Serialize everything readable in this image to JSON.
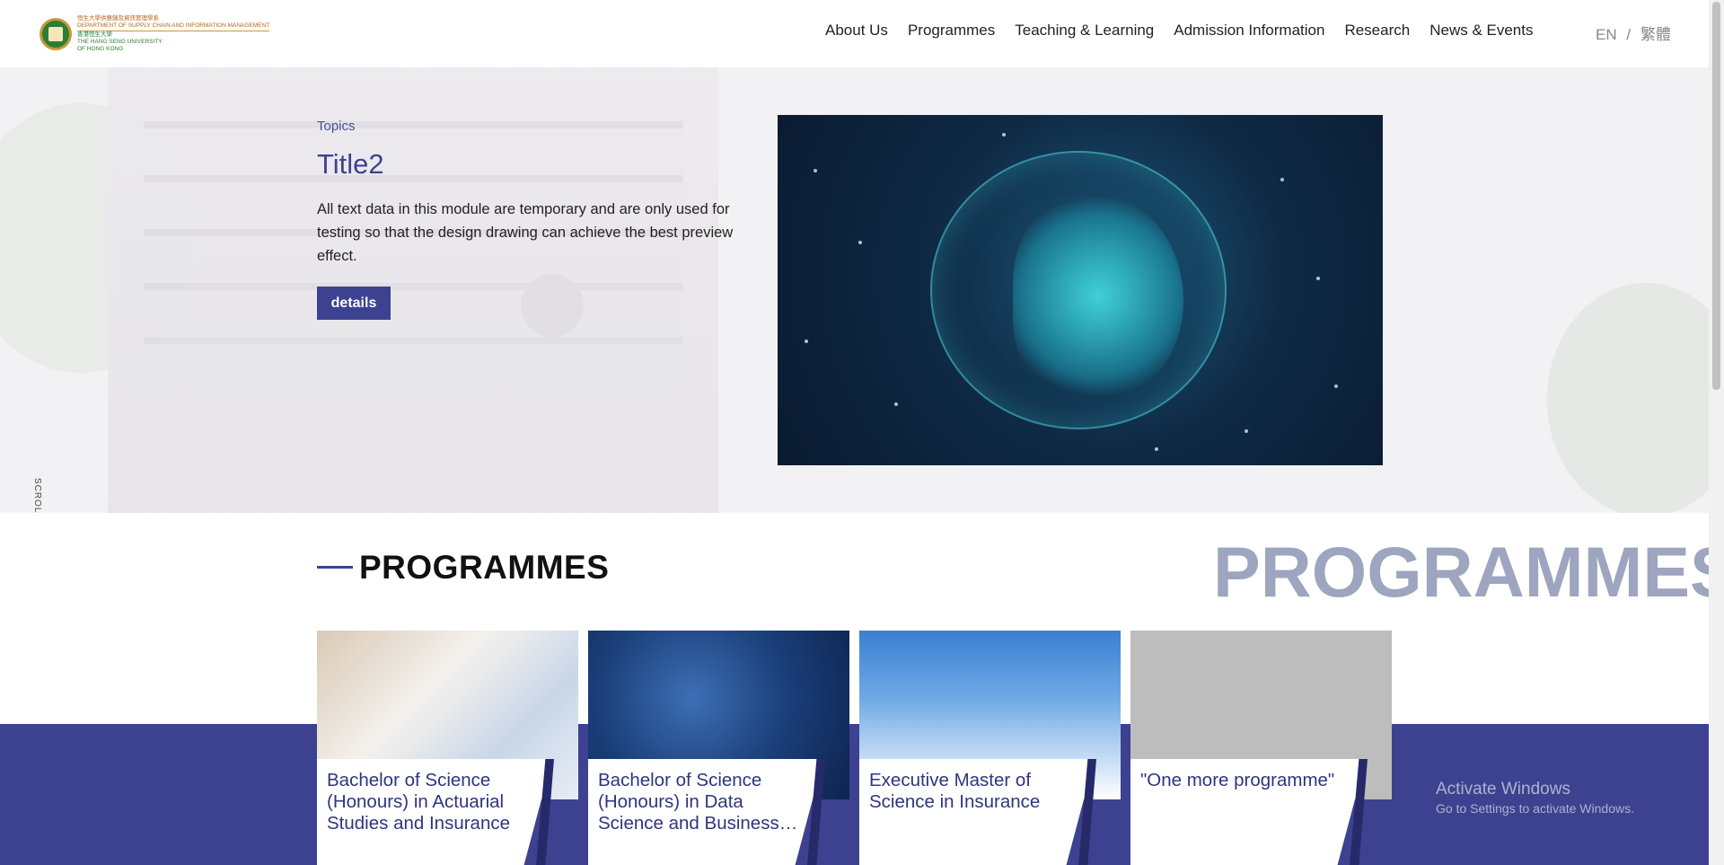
{
  "header": {
    "logo_lines": [
      "恒生大學供應鏈及資訊管理學系",
      "DEPARTMENT OF SUPPLY CHAIN AND INFORMATION MANAGEMENT",
      "香港恒生大學",
      "THE HANG SENG UNIVERSITY",
      "OF HONG KONG"
    ],
    "nav": [
      "About Us",
      "Programmes",
      "Teaching & Learning",
      "Admission Information",
      "Research",
      "News & Events"
    ],
    "lang_en": "EN",
    "lang_sep": "/",
    "lang_zh": "繁體"
  },
  "hero": {
    "topics": "Topics",
    "title": "Title2",
    "description": "All text data in this module are temporary and are only used for testing so that the design drawing can achieve the best preview effect.",
    "button": "details",
    "scroll": "SCROLL"
  },
  "programmes": {
    "heading": "PROGRAMMES",
    "background_text": "PROGRAMMES",
    "cards": [
      {
        "title": "Bachelor of Science (Honours) in Actuarial Studies and Insurance"
      },
      {
        "title": "Bachelor of Science (Honours) in Data Science and Business Intelligence"
      },
      {
        "title": "Executive Master of Science in Insurance"
      },
      {
        "title": "\"One more programme\""
      }
    ]
  },
  "watermark": {
    "line1": "Activate Windows",
    "line2": "Go to Settings to activate Windows."
  },
  "colors": {
    "accent": "#3d4290",
    "band": "#3d4290",
    "caption_text": "#2f3580"
  }
}
